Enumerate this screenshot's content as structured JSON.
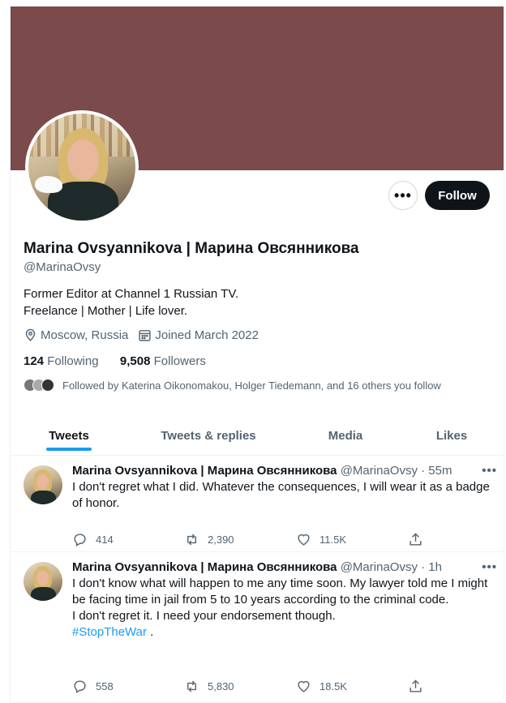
{
  "profile": {
    "name": "Marina Ovsyannikova | Марина Овсянникова",
    "handle": "@MarinaOvsy",
    "bio_line1": "Former Editor at Channel 1 Russian TV.",
    "bio_line2": "Freelance | Mother | Life lover.",
    "location": "Moscow, Russia",
    "joined": "Joined March 2022",
    "following_count": "124",
    "following_label": "Following",
    "followers_count": "9,508",
    "followers_label": "Followers",
    "followed_by": "Followed by Katerina Oikonomakou, Holger Tiedemann, and 16 others you follow",
    "follow_label": "Follow",
    "more_label": "•••",
    "banner_color": "#7b4a4a"
  },
  "tabs": [
    {
      "label": "Tweets"
    },
    {
      "label": "Tweets & replies"
    },
    {
      "label": "Media"
    },
    {
      "label": "Likes"
    }
  ],
  "tweets": [
    {
      "name": "Marina Ovsyannikova | Марина Овсянникова",
      "handle_time": "@MarinaOvsy · 55m",
      "lines": [
        "I don't regret what I did. Whatever the consequences, I will wear it as a badge of honor."
      ],
      "hashtag": "",
      "replies": "414",
      "retweets": "2,390",
      "likes": "11.5K"
    },
    {
      "name": "Marina Ovsyannikova | Марина Овсянникова",
      "handle_time": "@MarinaOvsy · 1h",
      "lines": [
        "I don't know what will happen to me any time soon. My lawyer told me I might be facing time in jail from 5 to 10 years according to the criminal code.",
        "I don't regret it. I need your endorsement though."
      ],
      "hashtag": "#StopTheWar",
      "hashtag_suffix": " .",
      "replies": "558",
      "retweets": "5,830",
      "likes": "18.5K"
    }
  ],
  "icons": {
    "location": "location-pin-icon",
    "calendar": "calendar-icon",
    "reply": "reply-icon",
    "retweet": "retweet-icon",
    "like": "heart-icon",
    "share": "share-icon"
  }
}
